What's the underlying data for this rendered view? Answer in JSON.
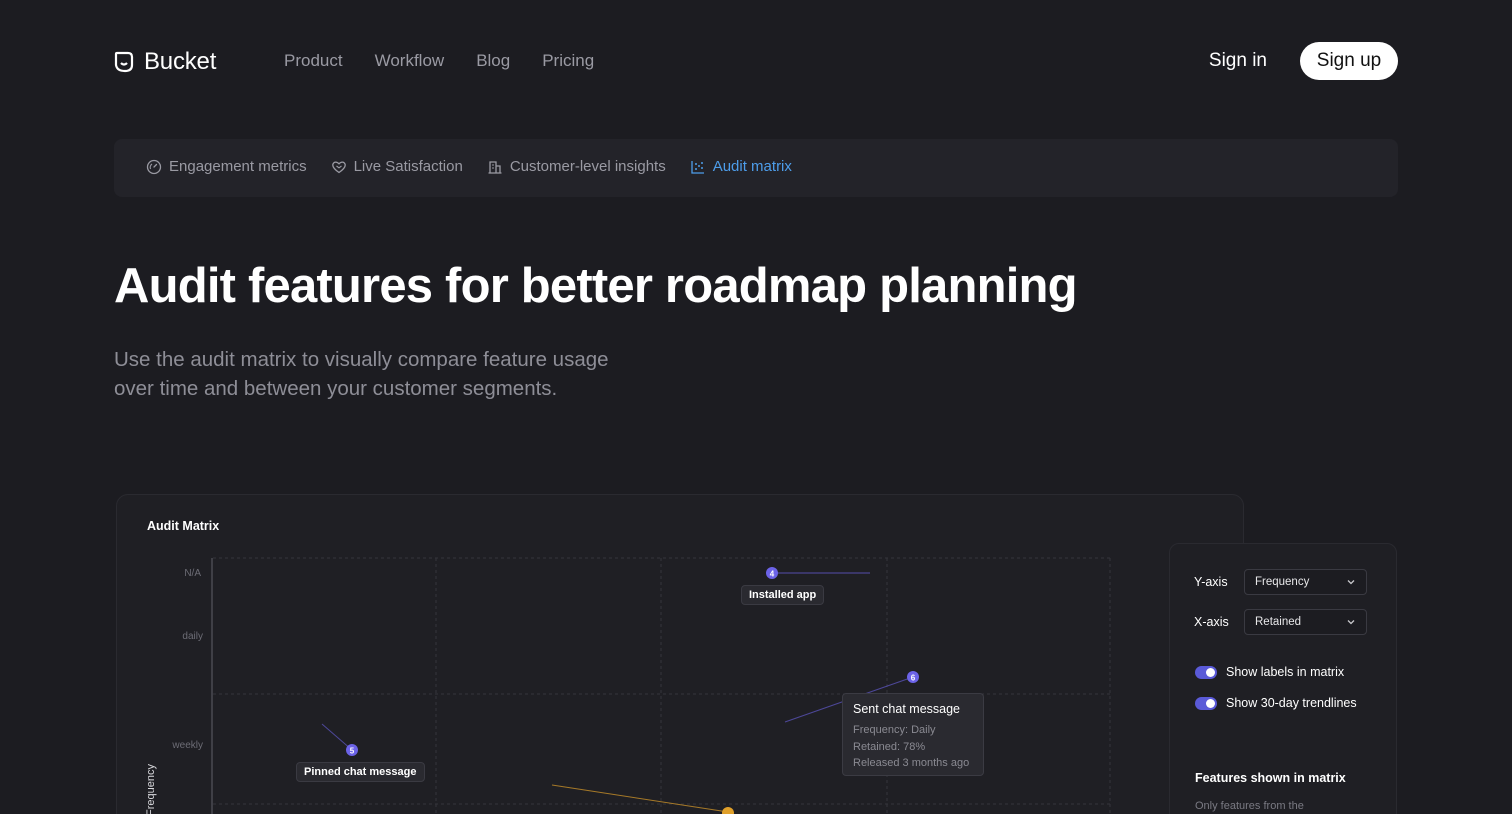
{
  "nav": {
    "brand": "Bucket",
    "brand_icon": "bucket-logo-icon",
    "links": [
      "Product",
      "Workflow",
      "Blog",
      "Pricing"
    ],
    "sign_in": "Sign in",
    "sign_up": "Sign up"
  },
  "tabs": [
    {
      "label": "Engagement metrics",
      "icon": "gauge-icon",
      "active": false
    },
    {
      "label": "Live Satisfaction",
      "icon": "heart-handshake-icon",
      "active": false
    },
    {
      "label": "Customer-level insights",
      "icon": "building-icon",
      "active": false
    },
    {
      "label": "Audit matrix",
      "icon": "scatter-chart-icon",
      "active": true
    }
  ],
  "hero": {
    "title": "Audit features for better roadmap planning",
    "subtitle": "Use the audit matrix to visually compare feature usage over time and between your customer segments."
  },
  "matrix": {
    "title": "Audit Matrix",
    "y_axis_label": "Frequency",
    "y_ticks": [
      "N/A",
      "daily",
      "weekly"
    ],
    "points": [
      {
        "id": "4",
        "label": "Installed app",
        "color": "#6c63e8"
      },
      {
        "id": "6",
        "label": "",
        "color": "#6c63e8"
      },
      {
        "id": "5",
        "label": "Pinned chat message",
        "color": "#6c63e8"
      }
    ],
    "tooltip": {
      "title": "Sent chat message",
      "frequency": "Frequency: Daily",
      "retained": "Retained: 78%",
      "released": "Released 3 months ago"
    },
    "accent_purple": "#6c63e8",
    "accent_orange": "#e0a02a"
  },
  "controls": {
    "y_axis_label": "Y-axis",
    "y_axis_value": "Frequency",
    "x_axis_label": "X-axis",
    "x_axis_value": "Retained",
    "toggle_labels": "Show labels in matrix",
    "toggle_labels_on": true,
    "toggle_trend": "Show 30-day trendlines",
    "toggle_trend_on": true,
    "features_title": "Features shown in matrix",
    "features_desc": "Only features from the"
  }
}
